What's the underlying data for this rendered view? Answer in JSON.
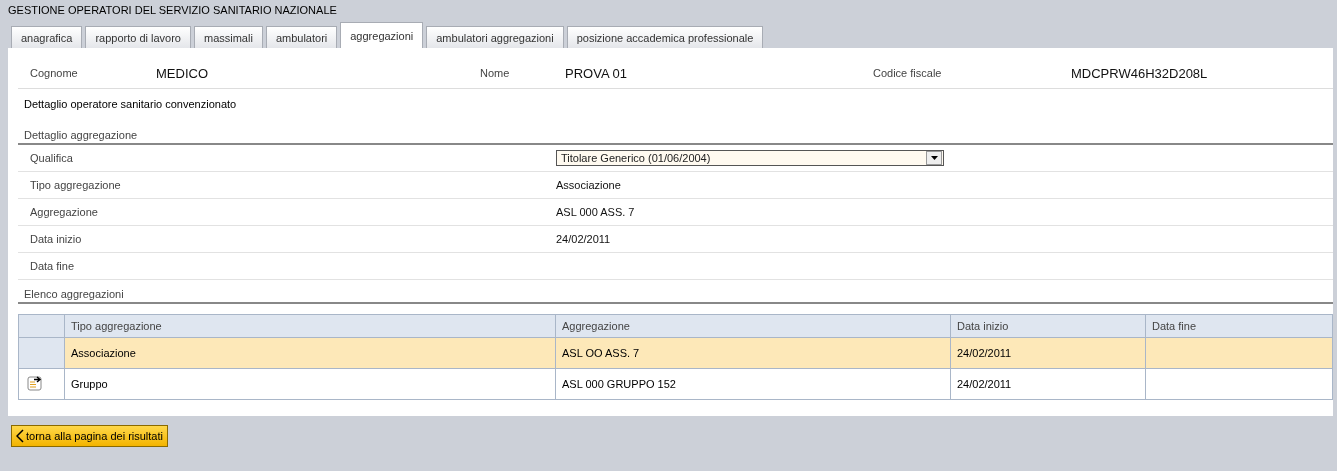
{
  "window": {
    "title": "GESTIONE OPERATORI DEL SERVIZIO SANITARIO NAZIONALE"
  },
  "tabs": [
    {
      "label": "anagrafica",
      "selected": false
    },
    {
      "label": "rapporto di lavoro",
      "selected": false
    },
    {
      "label": "massimali",
      "selected": false
    },
    {
      "label": "ambulatori",
      "selected": false
    },
    {
      "label": "aggregazioni",
      "selected": true
    },
    {
      "label": "ambulatori aggregazioni",
      "selected": false
    },
    {
      "label": "posizione accademica professionale",
      "selected": false
    }
  ],
  "header_fields": [
    {
      "label": "Cognome",
      "value": "MEDICO"
    },
    {
      "label": "Nome",
      "value": "PROVA 01"
    },
    {
      "label": "Codice fiscale",
      "value": "MDCPRW46H32D208L"
    }
  ],
  "subtitle": "Dettaglio operatore sanitario convenzionato",
  "detail_section": {
    "title": "Dettaglio aggregazione",
    "rows": [
      {
        "kind": "select",
        "label": "Qualifica",
        "value": "Titolare Generico (01/06/2004)"
      },
      {
        "kind": "text",
        "label": "Tipo aggregazione",
        "value": "Associazione"
      },
      {
        "kind": "text",
        "label": "Aggregazione",
        "value": "ASL 000 ASS. 7"
      },
      {
        "kind": "text",
        "label": "Data inizio",
        "value": "24/02/2011"
      },
      {
        "kind": "text",
        "label": "Data fine"
      }
    ]
  },
  "list_section": {
    "title": "Elenco aggregazioni",
    "table": {
      "columns": [
        "Tipo aggregazione",
        "Aggregazione",
        "Data inizio",
        "Data fine"
      ],
      "rows": [
        {
          "selected": true,
          "cells": [
            "Associazione",
            "ASL OO ASS. 7",
            "24/02/2011",
            ""
          ]
        },
        {
          "selected": false,
          "cells": [
            "Gruppo",
            "ASL 000 GRUPPO 152",
            "24/02/2011",
            ""
          ]
        }
      ]
    }
  },
  "back_button": {
    "label": "torna alla pagina dei risultati"
  }
}
